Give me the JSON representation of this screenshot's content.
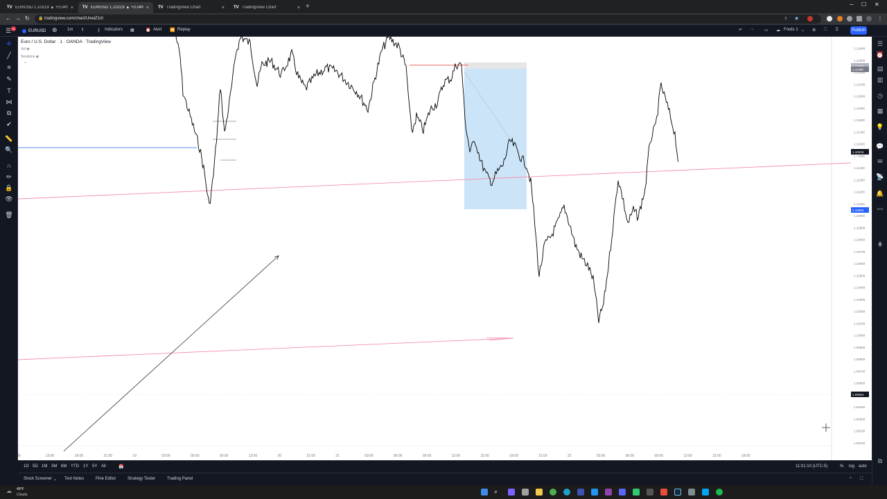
{
  "browser": {
    "tabs": [
      {
        "label": "EURUSD 1.10219 ▲ +0.04% Fre...",
        "active": false
      },
      {
        "label": "EURUSD 1.10219 ▲ +0.04% Fre...",
        "active": true
      },
      {
        "label": "TradingView Chart",
        "active": false
      },
      {
        "label": "TradingView Chart",
        "active": false
      }
    ],
    "url": "tradingview.com/chart/UnwiZ1rt/"
  },
  "toolbar": {
    "symbol": "EURUSD",
    "interval": "1m",
    "indicators_label": "Indicators",
    "alert_label": "Alert",
    "replay_label": "Replay",
    "layout_name": "Fredo 1",
    "publish_label": "Publish"
  },
  "legend": {
    "title": "Euro / U.S. Dollar · 1 · OANDA · TradingView",
    "sub1": "Vol",
    "sub2": "Sessions"
  },
  "chart_data": {
    "type": "candlestick",
    "symbol": "Euro / U.S. Dollar",
    "interval": "1",
    "source": "OANDA",
    "ylim": [
      1.091,
      1.1245
    ],
    "price_ticks": [
      "1.12500",
      "1.12400",
      "1.12300",
      "1.12200",
      "1.12100",
      "1.12000",
      "1.11900",
      "1.11800",
      "1.11700",
      "1.11600",
      "1.11500",
      "1.11400",
      "1.11300",
      "1.11200",
      "1.11100",
      "1.11000",
      "1.10900",
      "1.10800",
      "1.10700",
      "1.10600",
      "1.10500",
      "1.10400",
      "1.10300",
      "1.10200",
      "1.10100",
      "1.10000",
      "1.09900",
      "1.09800",
      "1.09700",
      "1.09600",
      "1.09500",
      "1.09400",
      "1.09300",
      "1.09200",
      "1.09100"
    ],
    "time_ticks": [
      "09",
      "15:00",
      "18:00",
      "21:00",
      "19",
      "03:00",
      "06:00",
      "09:00",
      "12:00",
      "20",
      "21:00",
      "21",
      "03:00",
      "06:00",
      "09:00",
      "12:00",
      "15:00",
      "18:00",
      "21:00",
      "22",
      "03:00",
      "06:00",
      "09:00",
      "12:00",
      "15:00",
      "18:00"
    ],
    "labels": {
      "last_price": "1.10219",
      "countdown": "00:50",
      "crosshair_price": "1.09454",
      "marker_blue": "1.10053",
      "marker_gray_top": "1.11449",
      "marker_gray_bottom": "1.11400"
    },
    "timezone_readout": "11:01:10 (UTC-5)"
  },
  "range_bar": {
    "ranges": [
      "1D",
      "5D",
      "1M",
      "3M",
      "6M",
      "YTD",
      "1Y",
      "5Y",
      "All"
    ],
    "clock": "11:01:10 (UTC-5)",
    "percent": "%",
    "log": "log",
    "auto": "auto"
  },
  "bottom_panel": {
    "tabs": [
      "Stock Screener",
      "Text Notes",
      "Pine Editor",
      "Strategy Tester",
      "Trading Panel"
    ]
  },
  "taskbar": {
    "weather_temp": "49°F",
    "weather_desc": "Cloudy"
  }
}
